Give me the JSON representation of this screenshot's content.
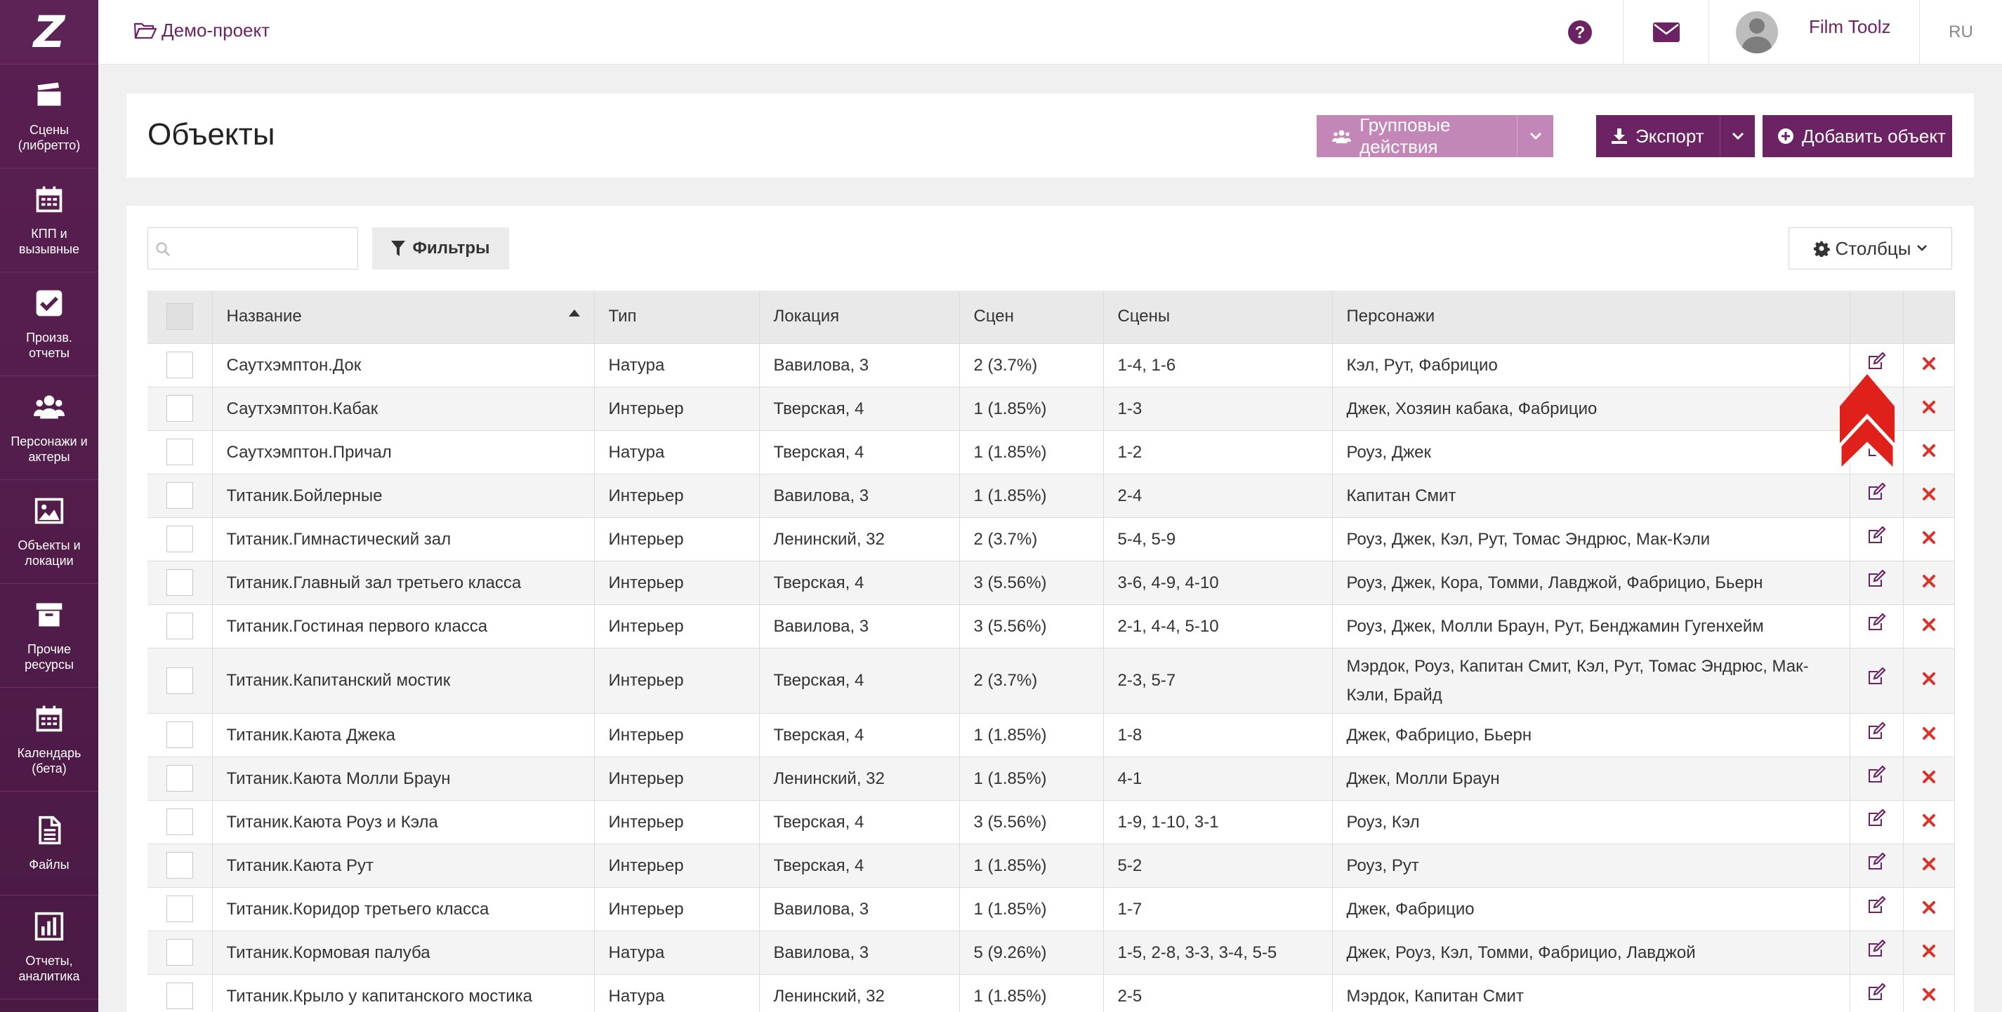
{
  "sidebar": {
    "logo": "Z",
    "items": [
      {
        "icon": "clapperboard-icon",
        "label": "Сцены (либретто)"
      },
      {
        "icon": "calendar-icon",
        "label": "КПП и вызывные"
      },
      {
        "icon": "checkbox-icon",
        "label": "Произв. отчеты"
      },
      {
        "icon": "users-icon",
        "label": "Персонажи и актеры"
      },
      {
        "icon": "image-icon",
        "label": "Объекты и локации"
      },
      {
        "icon": "archive-icon",
        "label": "Прочие ресурсы"
      },
      {
        "icon": "calendar-icon",
        "label": "Календарь (бета)"
      },
      {
        "icon": "file-icon",
        "label": "Файлы"
      },
      {
        "icon": "bar-chart-icon",
        "label": "Отчеты, аналитика"
      }
    ]
  },
  "topbar": {
    "breadcrumb": "Демо-проект",
    "user_name": "Film Toolz",
    "lang": "RU"
  },
  "header": {
    "title": "Объекты",
    "group_actions": "Групповые действия",
    "export": "Экспорт",
    "add_object": "Добавить объект"
  },
  "toolbar": {
    "search_placeholder": "",
    "filters": "Фильтры",
    "columns": "Столбцы"
  },
  "table": {
    "headers": [
      "Название",
      "Тип",
      "Локация",
      "Сцен",
      "Сцены",
      "Персонажи"
    ],
    "rows": [
      [
        "Саутхэмптон.Док",
        "Натура",
        "Вавилова, 3",
        "2 (3.7%)",
        "1-4, 1-6",
        "Кэл, Рут, Фабрицио"
      ],
      [
        "Саутхэмптон.Кабак",
        "Интерьер",
        "Тверская, 4",
        "1 (1.85%)",
        "1-3",
        "Джек, Хозяин кабака, Фабрицио"
      ],
      [
        "Саутхэмптон.Причал",
        "Натура",
        "Тверская, 4",
        "1 (1.85%)",
        "1-2",
        "Роуз, Джек"
      ],
      [
        "Титаник.Бойлерные",
        "Интерьер",
        "Вавилова, 3",
        "1 (1.85%)",
        "2-4",
        "Капитан Смит"
      ],
      [
        "Титаник.Гимнастический зал",
        "Интерьер",
        "Ленинский, 32",
        "2 (3.7%)",
        "5-4, 5-9",
        "Роуз, Джек, Кэл, Рут, Томас Эндрюс, Мак-Кэли"
      ],
      [
        "Титаник.Главный зал третьего класса",
        "Интерьер",
        "Тверская, 4",
        "3 (5.56%)",
        "3-6, 4-9, 4-10",
        "Роуз, Джек, Кора, Томми, Лавджой, Фабрицио, Бьерн"
      ],
      [
        "Титаник.Гостиная первого класса",
        "Интерьер",
        "Вавилова, 3",
        "3 (5.56%)",
        "2-1, 4-4, 5-10",
        "Роуз, Джек, Молли Браун, Рут, Бенджамин Гугенхейм"
      ],
      [
        "Титаник.Капитанский мостик",
        "Интерьер",
        "Тверская, 4",
        "2 (3.7%)",
        "2-3, 5-7",
        "Мэрдок, Роуз, Капитан Смит, Кэл, Рут, Томас Эндрюс, Мак-Кэли, Брайд"
      ],
      [
        "Титаник.Каюта Джека",
        "Интерьер",
        "Тверская, 4",
        "1 (1.85%)",
        "1-8",
        "Джек, Фабрицио, Бьерн"
      ],
      [
        "Титаник.Каюта Молли Браун",
        "Интерьер",
        "Ленинский, 32",
        "1 (1.85%)",
        "4-1",
        "Джек, Молли Браун"
      ],
      [
        "Титаник.Каюта Роуз и Кэла",
        "Интерьер",
        "Тверская, 4",
        "3 (5.56%)",
        "1-9, 1-10, 3-1",
        "Роуз, Кэл"
      ],
      [
        "Титаник.Каюта Рут",
        "Интерьер",
        "Тверская, 4",
        "1 (1.85%)",
        "5-2",
        "Роуз, Рут"
      ],
      [
        "Титаник.Коридор третьего класса",
        "Интерьер",
        "Вавилова, 3",
        "1 (1.85%)",
        "1-7",
        "Джек, Фабрицио"
      ],
      [
        "Титаник.Кормовая палуба",
        "Натура",
        "Вавилова, 3",
        "5 (9.26%)",
        "1-5, 2-8, 3-3, 3-4, 5-5",
        "Джек, Роуз, Кэл, Томми, Фабрицио, Лавджой"
      ],
      [
        "Титаник.Крыло у капитанского мостика",
        "Натура",
        "Ленинский, 32",
        "1 (1.85%)",
        "2-5",
        "Мэрдок, Капитан Смит"
      ]
    ]
  },
  "colors": {
    "brand": "#6b2363",
    "sidebar": "#5a1f52",
    "delete": "#d9342b",
    "annotation_arrow": "#e0201b"
  }
}
